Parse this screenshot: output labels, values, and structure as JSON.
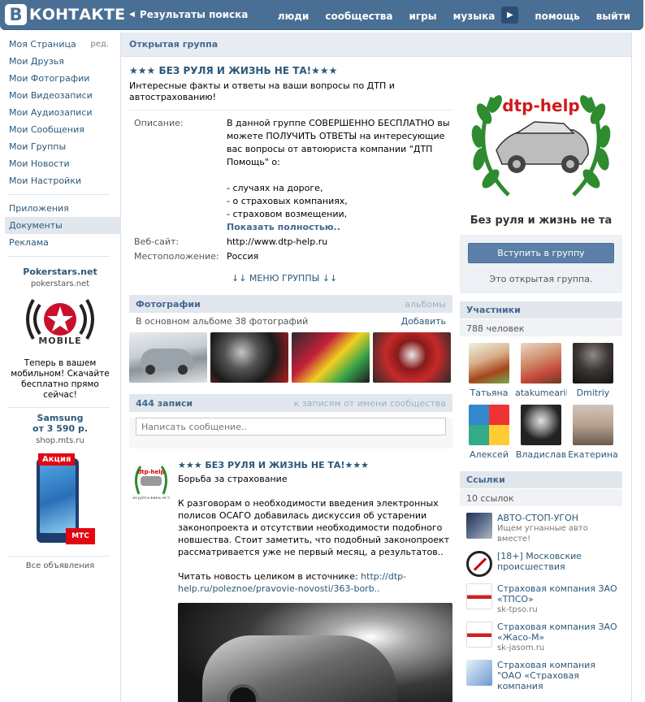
{
  "header": {
    "logo_letter": "В",
    "logo_text": "КОНТАКТЕ",
    "back_label": "Результаты поиска",
    "nav": [
      "люди",
      "сообщества",
      "игры",
      "музыка"
    ],
    "more_glyph": "▶",
    "nav_right": [
      "помощь",
      "выйти"
    ]
  },
  "sidebar": {
    "items": [
      {
        "label": "Моя Страница",
        "edit": "ред."
      },
      {
        "label": "Мои Друзья"
      },
      {
        "label": "Мои Фотографии"
      },
      {
        "label": "Мои Видеозаписи"
      },
      {
        "label": "Мои Аудиозаписи"
      },
      {
        "label": "Мои Сообщения"
      },
      {
        "label": "Мои Группы"
      },
      {
        "label": "Мои Новости"
      },
      {
        "label": "Мои Настройки"
      }
    ],
    "extra": [
      "Приложения",
      "Документы",
      "Реклама"
    ],
    "ads": [
      {
        "title": "Pokerstars.net",
        "domain": "pokerstars.net",
        "badge": "MOBILE",
        "text": "Теперь в вашем мобильном! Скачайте бесплатно прямо сейчас!"
      },
      {
        "title": "Samsung",
        "subtitle": "от 3 590 р.",
        "domain": "shop.mts.ru",
        "badge": "Акция",
        "brand": "МТС"
      }
    ],
    "all_ads": "Все объявления"
  },
  "main": {
    "header": "Открытая группа",
    "title": "★★★ БЕЗ РУЛЯ И ЖИЗНЬ НЕ ТА!★★★",
    "status": "Интересные факты и ответы на ваши вопросы по ДТП и автострахованию!",
    "description_label": "Описание:",
    "description": "В данной группе СОВЕРШЕННО БЕСПЛАТНО вы можете ПОЛУЧИТЬ ОТВЕТЫ на интересующие вас вопросы от автоюриста компании \"ДТП Помощь\" о:",
    "description_list": [
      "- случаях на дороге,",
      "- о страховых компаниях,",
      "- страховом возмещении,"
    ],
    "show_full": "Показать полностью..",
    "website_label": "Веб-сайт:",
    "website": "http://www.dtp-help.ru",
    "location_label": "Местоположение:",
    "location": "Россия",
    "menu": "↓↓ МЕНЮ ГРУППЫ ↓↓",
    "photos": {
      "title": "Фотографии",
      "right": "альбомы",
      "info": "В основном альбоме 38 фотографий",
      "add": "Добавить"
    },
    "wall": {
      "count": "444 записи",
      "right": "к записям от имени сообщества",
      "placeholder": "Написать сообщение.."
    },
    "post": {
      "author": "★★★ БЕЗ РУЛЯ И ЖИЗНЬ НЕ ТА!★★★",
      "headline": "Борьба за страхование",
      "text": "К разговорам о необходимости введения электронных полисов ОСАГО добавилась дискуссия об устарении законопроекта и отсутствии необходимости подобного новшества. Стоит заметить, что подобный законопроект рассматривается уже не первый месяц, а результатов..",
      "read_more": "Читать новость целиком в источнике:",
      "link": "http://dtp-help.ru/poleznoe/pravovie-novosti/363-borb.."
    }
  },
  "right": {
    "logo_text": "dtp-help",
    "caption": "Без руля и жизнь не та",
    "join": "Вступить в группу",
    "join_note": "Это открытая группа.",
    "members": {
      "title": "Участники",
      "count": "788 человек",
      "list": [
        {
          "name": "Татьяна",
          "color": "#c98a52"
        },
        {
          "name": "atakumearikuf",
          "color": "#c64a3c"
        },
        {
          "name": "Dmitriy",
          "color": "#3d3633"
        },
        {
          "name": "Алексей",
          "color": "#6c8a3c"
        },
        {
          "name": "Владислав",
          "color": "#222222"
        },
        {
          "name": "Екатерина",
          "color": "#8a7a6e"
        }
      ]
    },
    "links": {
      "title": "Ссылки",
      "count": "10 ссылок",
      "list": [
        {
          "title": "АВТО-СТОП-УГОН",
          "desc": "Ищем угнанные авто вместе!"
        },
        {
          "title": "[18+] Московские происшествия",
          "desc": ""
        },
        {
          "title": "Страховая компания ЗАО «ТПСО»",
          "desc": "sk-tpso.ru"
        },
        {
          "title": "Страховая компания ЗАО «Жасо-М»",
          "desc": "sk-jasom.ru"
        },
        {
          "title": "Страховая компания \"ОАО «Страховая компания",
          "desc": ""
        }
      ]
    }
  }
}
